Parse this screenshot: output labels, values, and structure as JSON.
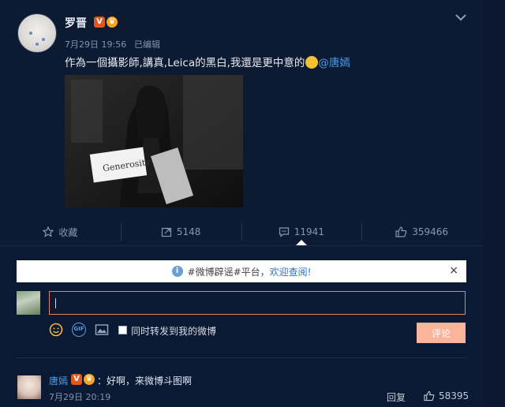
{
  "post": {
    "author": "罗晋",
    "verified_badge": "V",
    "time": "7月29日 19:56",
    "edited": "已编辑",
    "text": "作為一個攝影師,講真,Leica的黑白,我還是更中意的",
    "mention": "@唐嫣",
    "photo_sign": "Generosity"
  },
  "actions": {
    "favorite": "收藏",
    "repost": "5148",
    "comments": "11941",
    "likes": "359466"
  },
  "notice": {
    "prefix": "#微博辟谣#平台，",
    "link": "欢迎查阅!",
    "close": "×"
  },
  "composer": {
    "gif_label": "GIF",
    "checkbox_label": "同时转发到我的微博",
    "submit": "评论"
  },
  "comment": {
    "user": "唐嫣",
    "badge": "V",
    "text": "：好啊，来微博斗图啊",
    "time": "7月29日 20:19",
    "reply": "回复",
    "likes": "58395"
  },
  "colors": {
    "background": "#0d1b33",
    "mention": "#4d9fe8",
    "submit": "#f9b49b",
    "input_border": "#e8845a"
  }
}
